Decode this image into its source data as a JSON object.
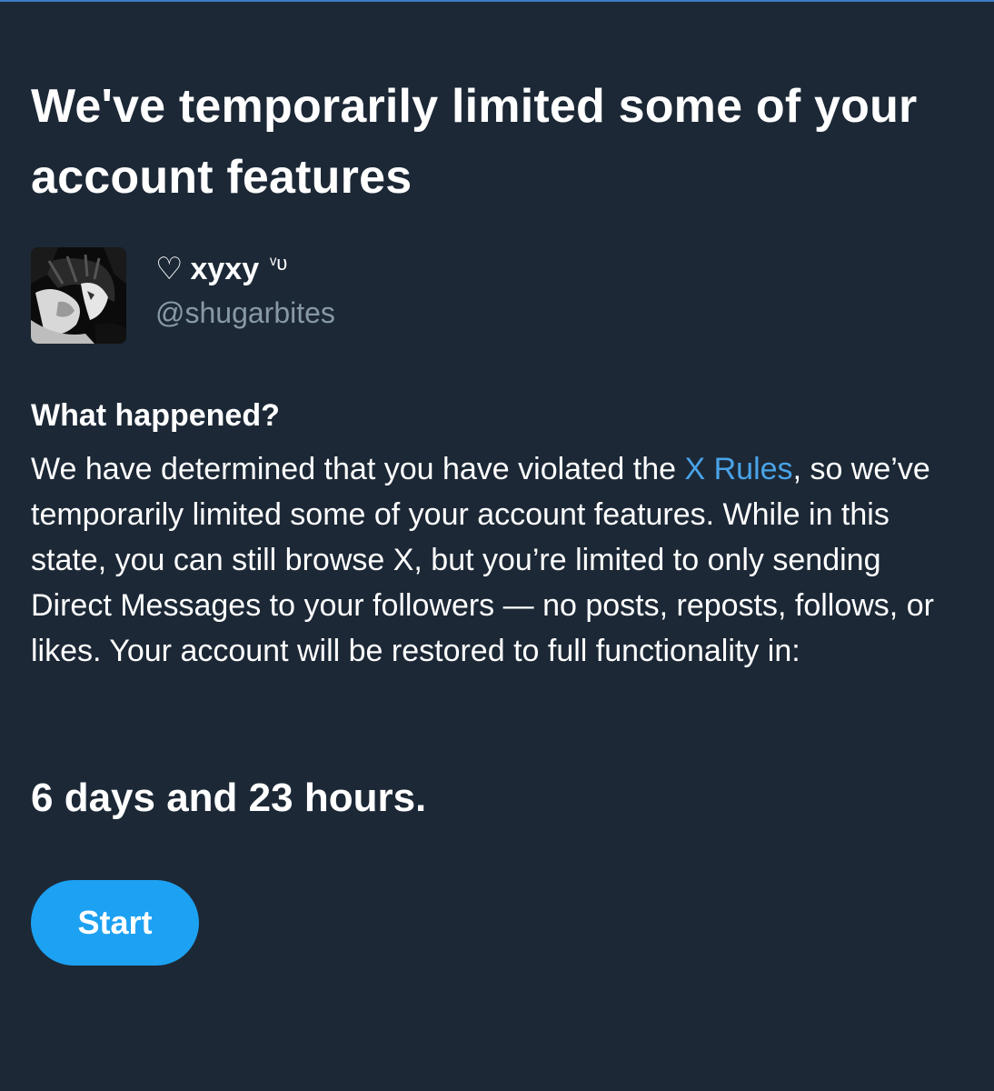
{
  "title": "We've temporarily limited some of your account features",
  "profile": {
    "heart_icon": "♡",
    "display_name": "xyxy",
    "name_suffix": "ᵛᴜ",
    "handle": "@shugarbites"
  },
  "section": {
    "heading": "What happened?",
    "body_before_link": "We have determined that you have violated the ",
    "link_text": "X Rules",
    "body_after_link": ", so we’ve temporarily limited some of your account features. While in this state, you can still browse X, but you’re limited to only sending Direct Messages to your followers — no posts, reposts, follows, or likes. Your account will be restored to full functionality in:"
  },
  "countdown": "6 days and 23 hours.",
  "start_button_label": "Start",
  "colors": {
    "background": "#1c2836",
    "accent": "#1da1f2",
    "link": "#4aa3e8",
    "muted_text": "#8899a6"
  }
}
